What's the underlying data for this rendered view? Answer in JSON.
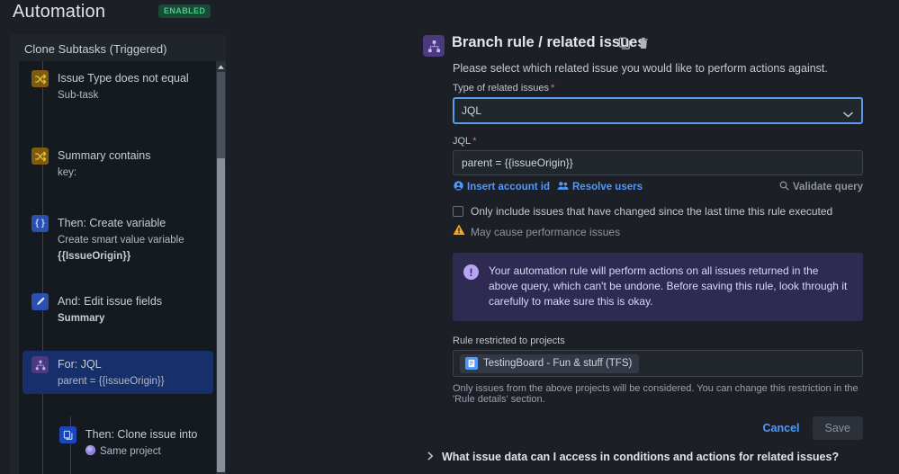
{
  "header": {
    "title": "Automation",
    "status_badge": "ENABLED"
  },
  "rule_panel": {
    "title": "Clone Subtasks (Triggered)",
    "nodes": [
      {
        "icon": "shuffle-icon",
        "title": "Issue Type does not equal",
        "sub": "Sub-task",
        "sub_bold": false,
        "selected": false
      },
      {
        "icon": "shuffle-icon",
        "title": "Summary contains",
        "sub": "key:",
        "sub_bold": false,
        "selected": false
      },
      {
        "icon": "braces-icon",
        "title": "Then: Create variable",
        "sub": "Create smart value variable",
        "sub2": "{{IssueOrigin}}",
        "sub_bold": false,
        "selected": false
      },
      {
        "icon": "pencil-icon",
        "title": "And: Edit issue fields",
        "sub": "Summary",
        "sub_bold": true,
        "selected": false
      },
      {
        "icon": "branch-icon",
        "title": "For: JQL",
        "sub": "parent = {{issueOrigin}}",
        "sub_bold": false,
        "selected": true
      },
      {
        "icon": "copy-icon",
        "title": "Then: Clone issue into",
        "sub": "Same project",
        "sub_bold": false,
        "selected": false
      }
    ]
  },
  "detail": {
    "icon": "branch-icon",
    "title": "Branch rule / related issues",
    "copy_action": "copy-icon",
    "delete_action": "trash-icon",
    "description": "Please select which related issue you would like to perform actions against.",
    "type_field": {
      "label": "Type of related issues",
      "required": true,
      "value": "JQL",
      "options": [
        "JQL"
      ]
    },
    "jql_field": {
      "label": "JQL",
      "required": true,
      "value": "parent = {{issueOrigin}}",
      "placeholder": ""
    },
    "links": {
      "insert_account_id": "Insert account id",
      "resolve_users": "Resolve users",
      "validate_query": "Validate query"
    },
    "checkbox": {
      "label": "Only include issues that have changed since the last time this rule executed",
      "checked": false
    },
    "perf_warning": "May cause performance issues",
    "info_banner": "Your automation rule will perform actions on all issues returned in the above query, which can't be undone. Before saving this rule, look through it carefully to make sure this is okay.",
    "restricted": {
      "label": "Rule restricted to projects",
      "project": "TestingBoard - Fun & stuff (TFS)",
      "note": "Only issues from the above projects will be considered. You can change this restriction in the 'Rule details' section."
    },
    "buttons": {
      "cancel": "Cancel",
      "save": "Save"
    },
    "faq": "What issue data can I access in conditions and actions for related issues?"
  },
  "colors": {
    "accent_blue": "#4c9aff",
    "enabled_green": "#4ec98a",
    "selected_node": "#17306b",
    "info_banner": "#2f2a52",
    "warning_amber": "#f0a830"
  }
}
